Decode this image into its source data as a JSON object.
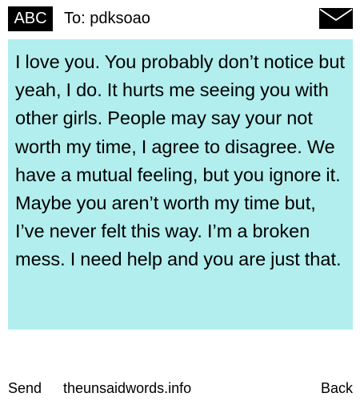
{
  "header": {
    "badge": "ABC",
    "to_line": "To: pdksoao",
    "icon": "envelope-icon"
  },
  "message": {
    "text": "I love you. You probably don’t notice but yeah, I do. It hurts me seeing you with other girls. People may say your not worth my time, I agree to disagree. We have a mutual feeling, but you ignore it. Maybe you aren’t worth my time but, I’ve never felt this way. I’m a broken mess. I need help and you are just that."
  },
  "footer": {
    "send_label": "Send",
    "site_label": "theunsaidwords.info",
    "back_label": "Back"
  },
  "colors": {
    "message_background": "#b2eeee",
    "badge_background": "#000000",
    "badge_text": "#ffffff",
    "text": "#000000"
  }
}
